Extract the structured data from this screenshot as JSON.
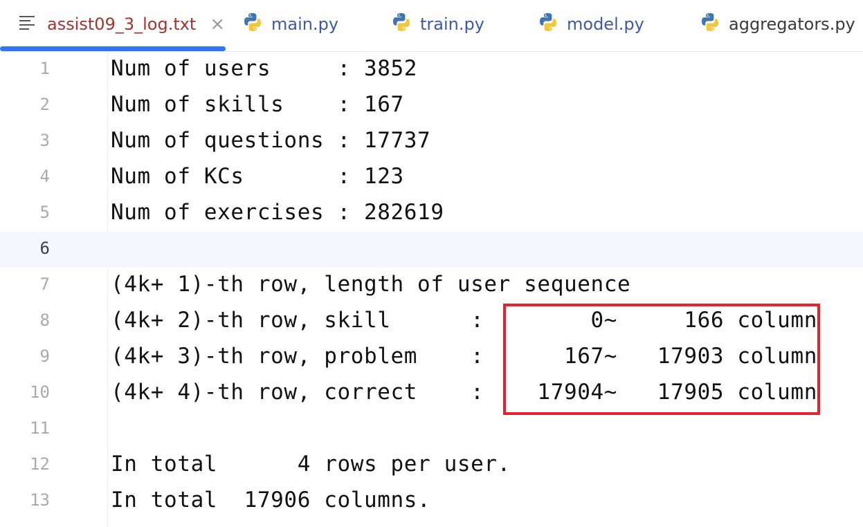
{
  "tabs": [
    {
      "label": "assist09_3_log.txt",
      "icon": "text-file-icon",
      "active": true,
      "closable": true
    },
    {
      "label": "main.py",
      "icon": "python-icon"
    },
    {
      "label": "train.py",
      "icon": "python-icon"
    },
    {
      "label": "model.py",
      "icon": "python-icon"
    },
    {
      "label": "aggregators.py",
      "icon": "python-icon"
    }
  ],
  "editor": {
    "current_line": 6,
    "lines": [
      {
        "n": "1",
        "text": "Num of users     : 3852"
      },
      {
        "n": "2",
        "text": "Num of skills    : 167"
      },
      {
        "n": "3",
        "text": "Num of questions : 17737"
      },
      {
        "n": "4",
        "text": "Num of KCs       : 123"
      },
      {
        "n": "5",
        "text": "Num of exercises : 282619"
      },
      {
        "n": "6",
        "text": ""
      },
      {
        "n": "7",
        "text": "(4k+ 1)-th row, length of user sequence"
      },
      {
        "n": "8",
        "text": "(4k+ 2)-th row, skill      :        0~     166 column"
      },
      {
        "n": "9",
        "text": "(4k+ 3)-th row, problem    :      167~   17903 column"
      },
      {
        "n": "10",
        "text": "(4k+ 4)-th row, correct    :    17904~   17905 column"
      },
      {
        "n": "11",
        "text": ""
      },
      {
        "n": "12",
        "text": "In total      4 rows per user."
      },
      {
        "n": "13",
        "text": "In total  17906 columns."
      }
    ]
  },
  "colors": {
    "active_tab_text": "#a8322d",
    "tab_text": "#3c5aa6",
    "active_underline": "#3574f0",
    "highlight_box": "#e8202a",
    "current_line_bg": "#f4f7fe"
  }
}
